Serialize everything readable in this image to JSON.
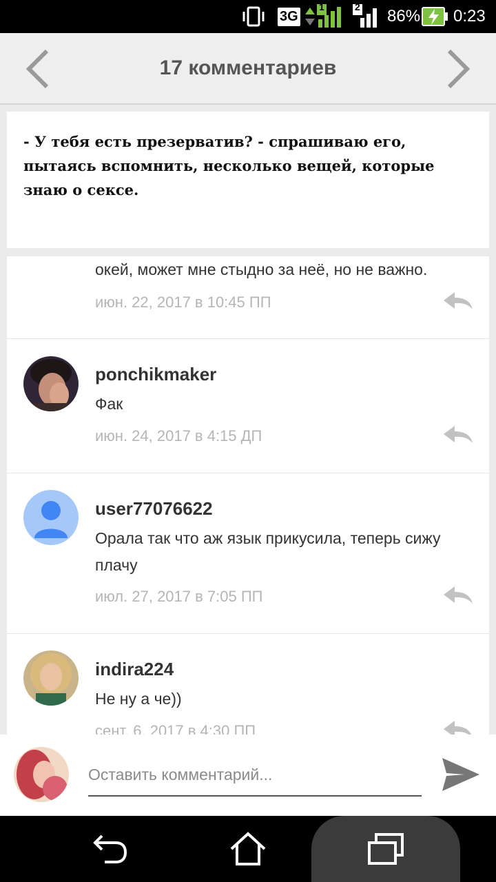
{
  "status_bar": {
    "network": "3G",
    "sim1": "1",
    "sim2": "2",
    "battery": "86%",
    "time": "0:23"
  },
  "header": {
    "title": "17 комментариев",
    "prev_icon": "chevron-left-icon",
    "next_icon": "chevron-right-icon"
  },
  "excerpt": {
    "text": "- У тебя есть презерватив? - спрашиваю его, пытаясь вспомнить, несколько вещей, которые знаю о сексе."
  },
  "comments": [
    {
      "author": "",
      "text": "окей, может мне стыдно за неё, но не важно.",
      "date": "июн. 22, 2017 в 10:45 ПП",
      "reply_icon": "reply-icon"
    },
    {
      "author": "ponchikmaker",
      "text": "Фак",
      "date": "июн. 24, 2017 в 4:15 ДП",
      "reply_icon": "reply-icon"
    },
    {
      "author": "user77076622",
      "text": "Орала так что аж язык прикусила, теперь сижу плачу",
      "date": "июл. 27, 2017 в 7:05 ПП",
      "reply_icon": "reply-icon"
    },
    {
      "author": "indira224",
      "text": "Не ну а че))",
      "date": "сент. 6, 2017 в 4:30 ПП",
      "reply_icon": "reply-icon"
    }
  ],
  "composer": {
    "placeholder": "Оставить комментарий...",
    "send_icon": "send-icon"
  },
  "android_nav": {
    "back_icon": "back-icon",
    "home_icon": "home-icon",
    "recents_icon": "recents-icon"
  },
  "colors": {
    "header_bg": "#eeeeee",
    "page_bg": "#ebebeb",
    "muted_text": "#b5b5b5",
    "default_avatar": "#4285f4"
  }
}
